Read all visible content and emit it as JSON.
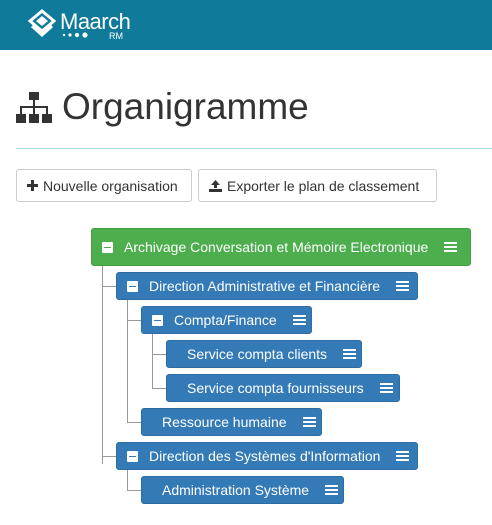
{
  "brand": {
    "name": "Maarch",
    "sub": "RM",
    "color": "#0f7a99"
  },
  "page": {
    "title": "Organigramme",
    "title_icon": "sitemap-icon"
  },
  "toolbar": {
    "new_org_label": "Nouvelle organisation",
    "new_org_icon": "plus-icon",
    "export_label": "Exporter le plan de classement",
    "export_icon": "upload-icon"
  },
  "tree": {
    "root": {
      "label": "Archivage Conversation et Mémoire Electronique",
      "expanded": true,
      "color": "#4cae4c"
    },
    "nodes": [
      {
        "label": "Direction Administrative et Financière",
        "expanded": true
      },
      {
        "label": "Compta/Finance",
        "expanded": true
      },
      {
        "label": "Service compta clients"
      },
      {
        "label": "Service compta fournisseurs"
      },
      {
        "label": "Ressource humaine"
      },
      {
        "label": "Direction des Systèmes d'Information",
        "expanded": true
      },
      {
        "label": "Administration Système"
      }
    ],
    "node_color": "#337ab7"
  }
}
